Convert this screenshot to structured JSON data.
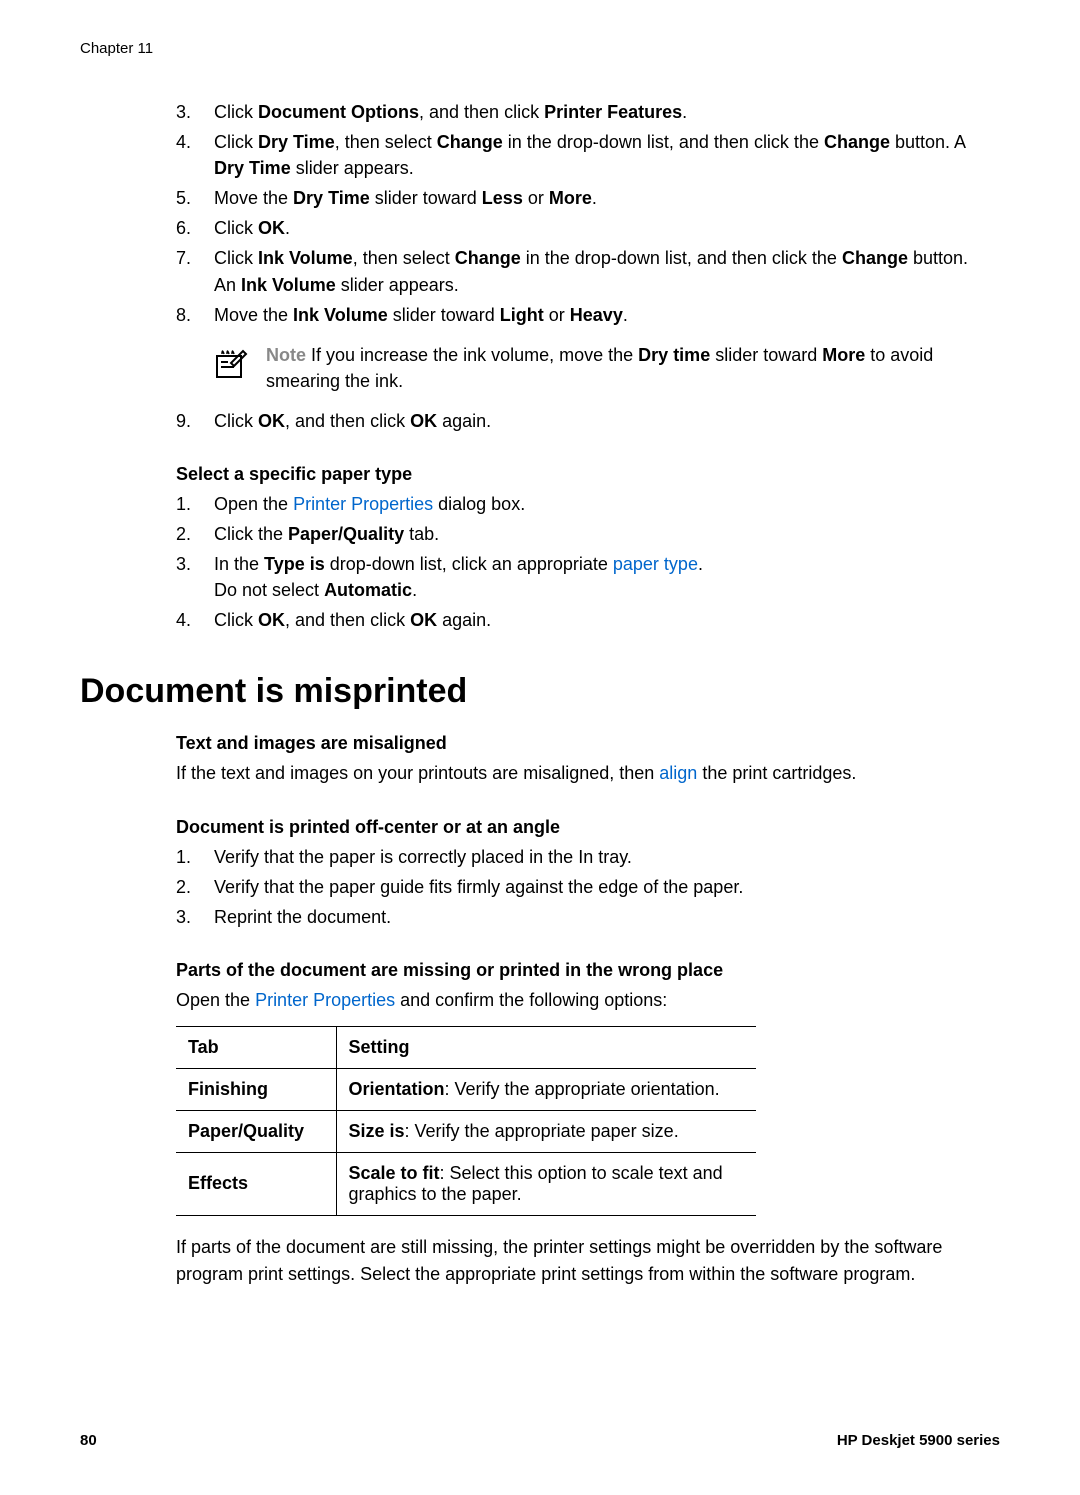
{
  "chapter": "Chapter 11",
  "listA": {
    "i3": {
      "n": "3.",
      "pre": "Click ",
      "b1": "Document Options",
      "mid": ", and then click ",
      "b2": "Printer Features",
      "post": "."
    },
    "i4": {
      "n": "4.",
      "pre": "Click ",
      "b1": "Dry Time",
      "mid1": ", then select ",
      "b2": "Change",
      "mid2": " in the drop-down list, and then click the ",
      "b3": "Change",
      "mid3": " button. A ",
      "b4": "Dry Time",
      "post": " slider appears."
    },
    "i5": {
      "n": "5.",
      "pre": "Move the ",
      "b1": "Dry Time",
      "mid": " slider toward ",
      "b2": "Less",
      "or": " or ",
      "b3": "More",
      "post": "."
    },
    "i6": {
      "n": "6.",
      "pre": "Click ",
      "b1": "OK",
      "post": "."
    },
    "i7": {
      "n": "7.",
      "pre": "Click ",
      "b1": "Ink Volume",
      "mid1": ", then select ",
      "b2": "Change",
      "mid2": " in the drop-down list, and then click the ",
      "b3": "Change",
      "mid3": " button. An ",
      "b4": "Ink Volume",
      "post": " slider appears."
    },
    "i8": {
      "n": "8.",
      "pre": "Move the ",
      "b1": "Ink Volume",
      "mid": " slider toward ",
      "b2": "Light",
      "or": " or ",
      "b3": "Heavy",
      "post": "."
    },
    "note": {
      "label": "Note",
      "pre": "   If you increase the ink volume, move the ",
      "b1": "Dry time",
      "mid": " slider toward ",
      "b2": "More",
      "post": " to avoid smearing the ink."
    },
    "i9": {
      "n": "9.",
      "pre": "Click ",
      "b1": "OK",
      "mid": ", and then click ",
      "b2": "OK",
      "post": " again."
    }
  },
  "subA": "Select a specific paper type",
  "listB": {
    "i1": {
      "n": "1.",
      "pre": "Open the ",
      "link": "Printer Properties",
      "post": " dialog box."
    },
    "i2": {
      "n": "2.",
      "pre": "Click the ",
      "b1": "Paper/Quality",
      "post": " tab."
    },
    "i3": {
      "n": "3.",
      "pre": "In the ",
      "b1": "Type is",
      "mid": " drop-down list, click an appropriate ",
      "link": "paper type",
      "post1": ".",
      "line2pre": "Do not select ",
      "b2": "Automatic",
      "post2": "."
    },
    "i4": {
      "n": "4.",
      "pre": "Click ",
      "b1": "OK",
      "mid": ", and then click ",
      "b2": "OK",
      "post": " again."
    }
  },
  "heading": "Document is misprinted",
  "subB": "Text and images are misaligned",
  "paraB": {
    "pre": "If the text and images on your printouts are misaligned, then ",
    "link": "align",
    "post": " the print cartridges."
  },
  "subC": "Document is printed off-center or at an angle",
  "listC": {
    "i1": {
      "n": "1.",
      "t": "Verify that the paper is correctly placed in the In tray."
    },
    "i2": {
      "n": "2.",
      "t": "Verify that the paper guide fits firmly against the edge of the paper."
    },
    "i3": {
      "n": "3.",
      "t": "Reprint the document."
    }
  },
  "subD": "Parts of the document are missing or printed in the wrong place",
  "paraD": {
    "pre": "Open the ",
    "link": "Printer Properties",
    "post": " and confirm the following options:"
  },
  "table": {
    "h1": "Tab",
    "h2": "Setting",
    "r1c1": "Finishing",
    "r1b": "Orientation",
    "r1t": ": Verify the appropriate orientation.",
    "r2c1": "Paper/Quality",
    "r2b": "Size is",
    "r2t": ": Verify the appropriate paper size.",
    "r3c1": "Effects",
    "r3b": "Scale to fit",
    "r3t": ": Select this option to scale text and graphics to the paper."
  },
  "paraE": "If parts of the document are still missing, the printer settings might be overridden by the software program print settings. Select the appropriate print settings from within the software program.",
  "footer": {
    "page": "80",
    "model": "HP Deskjet 5900 series"
  }
}
